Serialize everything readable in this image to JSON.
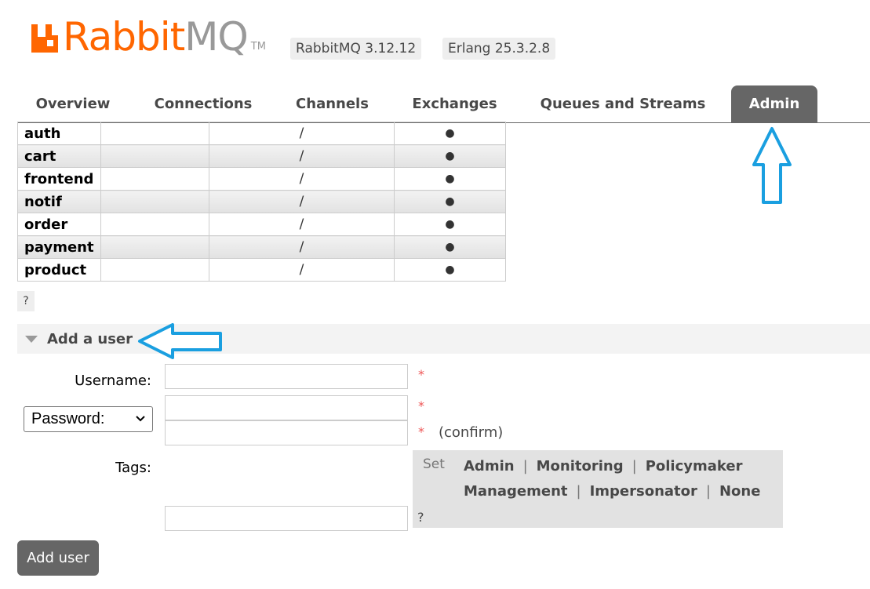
{
  "header": {
    "logo_rabbit": "Rabbit",
    "logo_mq": "MQ",
    "logo_tm": "TM",
    "version_rabbitmq": "RabbitMQ 3.12.12",
    "version_erlang": "Erlang 25.3.2.8",
    "brand_color": "#ff6600"
  },
  "tabs": [
    {
      "label": "Overview"
    },
    {
      "label": "Connections"
    },
    {
      "label": "Channels"
    },
    {
      "label": "Exchanges"
    },
    {
      "label": "Queues and Streams"
    },
    {
      "label": "Admin",
      "active": true
    }
  ],
  "vhost_table": {
    "rows": [
      {
        "user": "auth",
        "vhost": "/",
        "mark": "●"
      },
      {
        "user": "cart",
        "vhost": "/",
        "mark": "●"
      },
      {
        "user": "frontend",
        "vhost": "/",
        "mark": "●"
      },
      {
        "user": "notif",
        "vhost": "/",
        "mark": "●"
      },
      {
        "user": "order",
        "vhost": "/",
        "mark": "●"
      },
      {
        "user": "payment",
        "vhost": "/",
        "mark": "●"
      },
      {
        "user": "product",
        "vhost": "/",
        "mark": "●"
      }
    ],
    "help": "?"
  },
  "add_user": {
    "title": "Add a user",
    "username_label": "Username:",
    "username_value": "",
    "password_select": "Password:",
    "password_value": "",
    "confirm_value": "",
    "confirm_label": "(confirm)",
    "required_mark": "*",
    "tags_label": "Tags:",
    "tags_value": "",
    "tags_set": "Set",
    "tag_options": [
      "Admin",
      "Monitoring",
      "Policymaker",
      "Management",
      "Impersonator",
      "None"
    ],
    "tag_separator": "|",
    "tags_help": "?",
    "submit_label": "Add user"
  },
  "annotation_color": "#1a9fe0"
}
